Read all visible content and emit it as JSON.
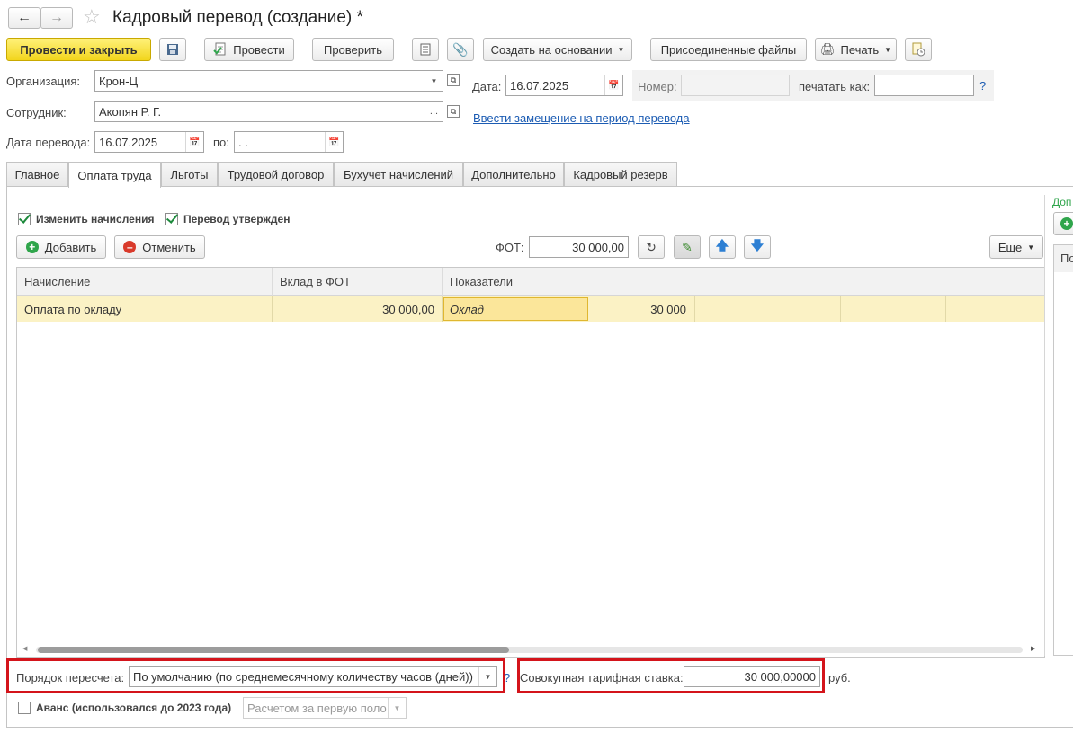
{
  "header": {
    "title": "Кадровый перевод (создание) *",
    "back_icon": "arrow-left-icon",
    "forward_icon": "arrow-right-icon",
    "favorite_icon": "star-icon"
  },
  "toolbar": {
    "post_close": "Провести и закрыть",
    "post": "Провести",
    "check": "Проверить",
    "create_based": "Создать на основании",
    "attached_files": "Присоединенные файлы",
    "print": "Печать"
  },
  "form": {
    "org_label": "Организация:",
    "org_value": "Крон-Ц",
    "employee_label": "Сотрудник:",
    "employee_value": "Акопян Р. Г.",
    "date_label": "Дата:",
    "date_value": "16.07.2025",
    "number_label": "Номер:",
    "number_value": "",
    "print_as_label": "печатать как:",
    "print_as_value": "",
    "help_mark": "?",
    "replacement_link": "Ввести замещение на период перевода",
    "transfer_date_label": "Дата перевода:",
    "transfer_date_value": "16.07.2025",
    "to_label": "по:",
    "to_value": " .  ."
  },
  "tabs": [
    {
      "label": "Главное"
    },
    {
      "label": "Оплата труда"
    },
    {
      "label": "Льготы"
    },
    {
      "label": "Трудовой договор"
    },
    {
      "label": "Бухучет начислений"
    },
    {
      "label": "Дополнительно"
    },
    {
      "label": "Кадровый резерв"
    }
  ],
  "pay": {
    "change_accruals": "Изменить начисления",
    "transfer_approved": "Перевод утвержден",
    "add": "Добавить",
    "cancel": "Отменить",
    "fot_label": "ФОТ:",
    "fot_value": "30 000,00",
    "more": "Еще",
    "right_panel_top": "Доп",
    "right_panel_col": "По"
  },
  "table": {
    "columns": [
      "Начисление",
      "Вклад в ФОТ",
      "Показатели"
    ],
    "rows": [
      {
        "accrual": "Оплата по окладу",
        "contribution": "30 000,00",
        "indicator": "Оклад",
        "indicator_value": "30 000"
      }
    ]
  },
  "footer": {
    "recalc_label": "Порядок пересчета:",
    "recalc_value": "По умолчанию (по среднемесячному количеству часов (дней))",
    "help_mark": "?",
    "rate_label": "Совокупная тарифная ставка:",
    "rate_value": "30 000,00000",
    "currency": "руб.",
    "advance_label": "Аванс (использовался до 2023 года)",
    "advance_value": "Расчетом за первую поло"
  },
  "colors": {
    "accent_yellow": "#f6dc2a",
    "row_highlight": "#fbf2c5",
    "cell_selected": "#fbe69a",
    "annotation_red": "#d4141b",
    "link_blue": "#1c5cb3",
    "add_green": "#2fa54b",
    "cancel_red": "#d93a2b",
    "arrow_blue": "#2d7fd3"
  }
}
